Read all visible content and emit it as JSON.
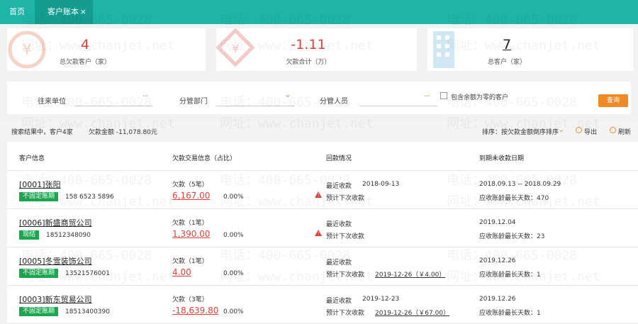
{
  "tabs": {
    "home": "首页",
    "active": "客户账本",
    "close": "×"
  },
  "summary": {
    "debtor_count": "4",
    "debtor_label": "总欠款客户（家）",
    "debt_total": "-1.11",
    "debt_total_label": "欠款合计（万）",
    "customer_total": "7",
    "customer_label": "总客户（家）"
  },
  "filter": {
    "unit_label": "往来单位",
    "dept_label": "分管部门",
    "staff_label": "分管人员",
    "dots": "···",
    "chevron": "⌄",
    "zero_checkbox_label": "包含余额为零的客户",
    "query_button": "查询"
  },
  "results": {
    "summary": "搜索结果中，客户4家",
    "amount": "欠款金额 -11,078.80元",
    "sort": "排序：按欠款金额倒序排序",
    "export": "导出",
    "refresh": "刷新"
  },
  "table": {
    "headers": [
      "客户信息",
      "欠款交易信息（占比）",
      "回款情况",
      "到期未收款日期"
    ],
    "rows": [
      {
        "name": "[0001]张阳",
        "badge": "不固定账期",
        "badge_color": "#1aa84f",
        "phone": "158 6523 5896",
        "debt_label": "欠款（5笔）",
        "amount": "6,167.00",
        "pct": "0.00%",
        "warn": true,
        "recv_label": "最近收款",
        "recv_date": "2018-09-13",
        "next_label": "预计下次收款",
        "next_value": "",
        "due_range": "2018.09.13 -- 2018.09.29",
        "age_label": "应收账龄最长天数：470"
      },
      {
        "name": "[0006]新盛商贸公司",
        "badge": "现结",
        "badge_color": "#1aa84f",
        "phone": "18512348090",
        "debt_label": "欠款（1笔）",
        "amount": "1,390.00",
        "pct": "0.00%",
        "warn": true,
        "recv_label": "最近收款",
        "recv_date": "",
        "next_label": "预计下次收款",
        "next_value": "",
        "due_range": "2019.12.04",
        "age_label": "应收账龄最长天数：23"
      },
      {
        "name": "[0005]冬雪装饰公司",
        "badge": "不固定账期",
        "badge_color": "#1aa84f",
        "phone": "13521576001",
        "debt_label": "欠款（1笔）",
        "amount": "4.00",
        "pct": "0.00%",
        "warn": false,
        "recv_label": "最近收款",
        "recv_date": "",
        "next_label": "预计下次收款",
        "next_value": "2019-12-26（￥4.00）",
        "due_range": "2019.12.26",
        "age_label": "应收账龄最长天数：1"
      },
      {
        "name": "[0003]新东贸易公司",
        "badge": "不固定账期",
        "badge_color": "#1aa84f",
        "phone": "18513400390",
        "debt_label": "欠款（3笔）",
        "amount": "-18,639.80",
        "pct": "0.00%",
        "warn": false,
        "recv_label": "最近收款",
        "recv_date": "2019-12-23",
        "next_label": "预计下次收款",
        "next_value": "2019-12-26（￥67.00）",
        "due_range": "2019.12.26",
        "age_label": "应收账龄最长天数：1"
      }
    ]
  },
  "watermark": {
    "phone": "电话：400-665-0028",
    "site": "网址：www.chanjet.net"
  },
  "colors": {
    "accent": "#1fb5a6",
    "orange": "#f08a24",
    "red": "#e0413b",
    "green": "#1aa84f"
  }
}
